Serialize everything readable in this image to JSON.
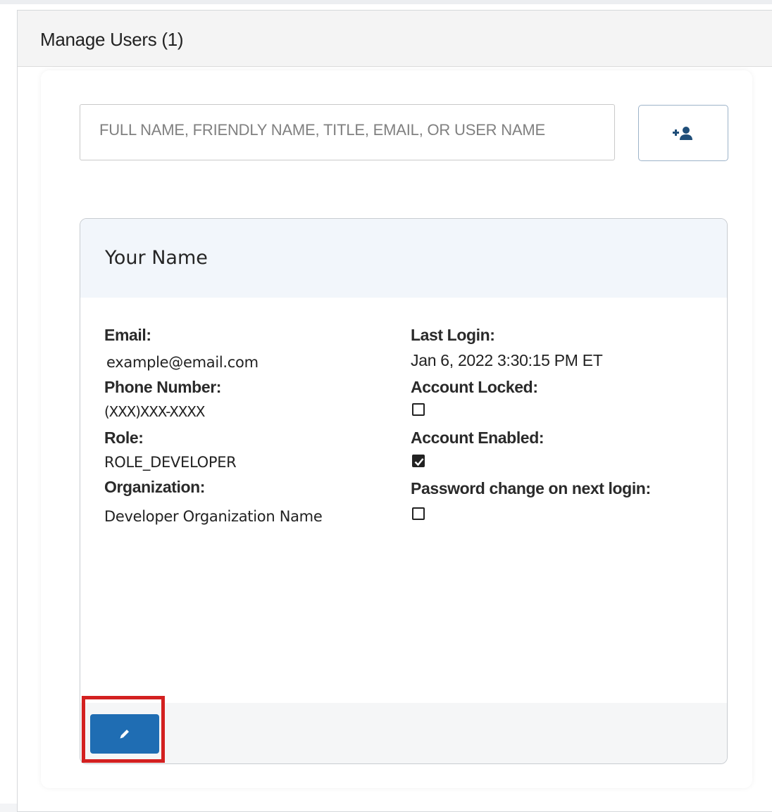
{
  "panel": {
    "title": "Manage Users (1)"
  },
  "search": {
    "placeholder": "FULL NAME, FRIENDLY NAME, TITLE, EMAIL, OR USER NAME"
  },
  "add_user_button": {
    "icon": "add-user-icon",
    "color": "#1f4e79"
  },
  "user": {
    "name": "Your Name",
    "email_label": "Email:",
    "email": "example@email.com",
    "phone_label": "Phone Number:",
    "phone": "(XXX)XXX-XXXX",
    "role_label": "Role:",
    "role": "ROLE_DEVELOPER",
    "organization_label": "Organization:",
    "organization": "Developer Organization Name",
    "last_login_label": "Last Login:",
    "last_login": "Jan 6, 2022 3:30:15 PM ET",
    "account_locked_label": "Account Locked:",
    "account_locked": false,
    "account_enabled_label": "Account Enabled:",
    "account_enabled": true,
    "password_change_label": "Password change on next login:",
    "password_change": false
  },
  "edit_button": {
    "icon": "pencil-icon",
    "color": "#1f6db3"
  },
  "highlight": {
    "color": "#d32020"
  }
}
